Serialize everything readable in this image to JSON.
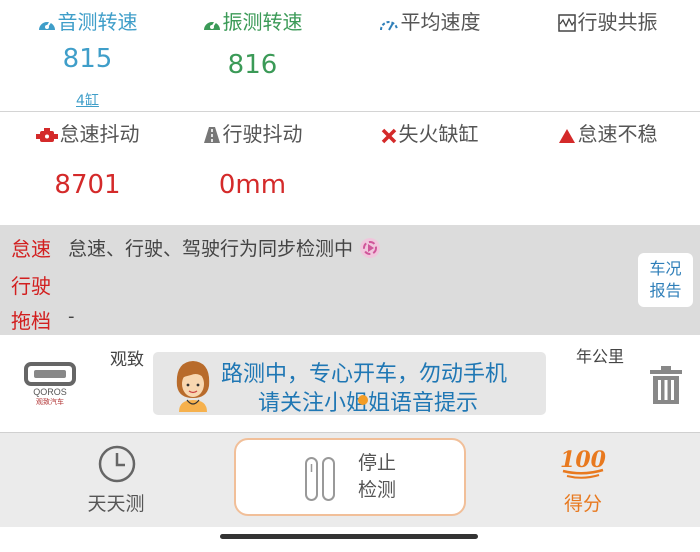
{
  "metrics_row1": [
    {
      "title": "音测转速",
      "value": "815",
      "sub": "4缸",
      "icon": "gauge-icon",
      "color": "#3f9ec9"
    },
    {
      "title": "振测转速",
      "value": "816",
      "icon": "gauge-icon",
      "color": "#3b9a57"
    },
    {
      "title": "平均速度",
      "value": "",
      "icon": "speedometer-icon",
      "color": "#555555"
    },
    {
      "title": "行驶共振",
      "value": "",
      "icon": "resonance-chart-icon",
      "color": "#555555"
    }
  ],
  "metrics_row2": [
    {
      "title": "怠速抖动",
      "value": "8701",
      "icon": "engine-icon",
      "color": "#d42a2a"
    },
    {
      "title": "行驶抖动",
      "value": "0mm",
      "icon": "road-icon",
      "color": "#d42a2a"
    },
    {
      "title": "失火缺缸",
      "value": "",
      "icon": "cross-icon",
      "color": "#d42a2a"
    },
    {
      "title": "怠速不稳",
      "value": "",
      "icon": "warning-triangle-icon",
      "color": "#d42a2a"
    }
  ],
  "status": {
    "modes": [
      "怠速",
      "行驶",
      "拖档"
    ],
    "detecting_text": "怠速、行驶、驾驶行为同步检测中",
    "gear_value": "-",
    "report_line1": "车况",
    "report_line2": "报告"
  },
  "car": {
    "name": "观致",
    "logo_text": "QOROS",
    "logo_sub": "观致汽车",
    "mileage_label": "年公里"
  },
  "notice": {
    "line1": "路测中，专心开车，勿动手机",
    "line2": "请关注小姐姐语音提示"
  },
  "nav": {
    "daily_label": "天天测",
    "stop_line1": "停止",
    "stop_line2": "检测",
    "score_label": "得分",
    "score_icon_text": "100"
  },
  "colors": {
    "accent_blue": "#3f9ec9",
    "accent_green": "#3b9a57",
    "alert_red": "#d42a2a",
    "orange": "#e8791f"
  }
}
